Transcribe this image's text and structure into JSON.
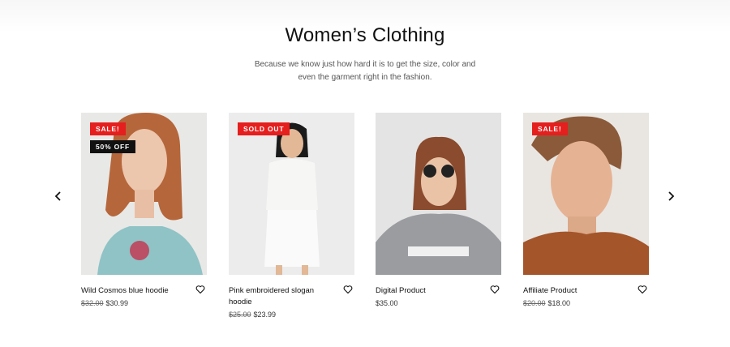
{
  "section": {
    "title": "Women’s Clothing",
    "subtitle_line1": "Because we know just how hard it is to get the size, color and",
    "subtitle_line2": "even the garment right in the fashion."
  },
  "carousel": {
    "prev_icon": "chevron-left-icon",
    "next_icon": "chevron-right-icon",
    "products": [
      {
        "name": "Wild Cosmos blue hoodie",
        "old_price": "$32.00",
        "price": "$30.99",
        "badges": [
          "SALE!",
          "50% OFF"
        ]
      },
      {
        "name": "Pink embroidered slogan hoodie",
        "old_price": "$25.00",
        "price": "$23.99",
        "badges": [
          "SOLD OUT"
        ]
      },
      {
        "name": "Digital Product",
        "old_price": "",
        "price": "$35.00",
        "badges": []
      },
      {
        "name": "Affiliate Product",
        "old_price": "$20.00",
        "price": "$18.00",
        "badges": [
          "SALE!"
        ]
      }
    ]
  },
  "colors": {
    "badge_red": "#e51e1e",
    "badge_black": "#111111"
  }
}
